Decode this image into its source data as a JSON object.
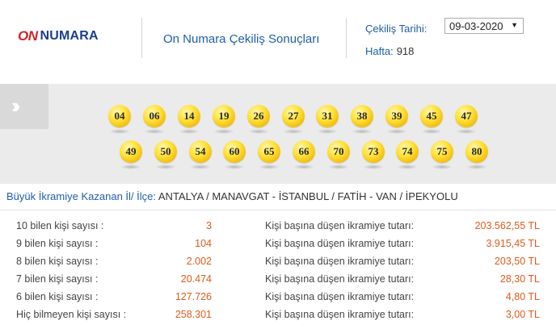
{
  "header": {
    "logo_on": "ON",
    "logo_numara": "NUMARA",
    "page_title": "On Numara Çekiliş Sonuçları",
    "date_label": "Çekiliş Tarihi:",
    "date_value": "09-03-2020",
    "week_label": "Hafta:",
    "week_value": "918"
  },
  "balls": {
    "row1": [
      "04",
      "06",
      "14",
      "19",
      "26",
      "27",
      "31",
      "38",
      "39",
      "45",
      "47"
    ],
    "row2": [
      "49",
      "50",
      "54",
      "60",
      "65",
      "66",
      "70",
      "73",
      "74",
      "75",
      "80"
    ]
  },
  "winners": {
    "label": "Büyük İkramiye Kazanan İl/ İlçe:",
    "value": "ANTALYA / MANAVGAT - İSTANBUL / FATİH - VAN / İPEKYOLU"
  },
  "results": [
    {
      "label": "10 bilen kişi sayısı :",
      "count": "3",
      "prize_label": "Kişi başına düşen ikramiye tutarı:",
      "prize": "203.562,55 TL"
    },
    {
      "label": "9 bilen kişi sayısı :",
      "count": "104",
      "prize_label": "Kişi başına düşen ikramiye tutarı:",
      "prize": "3.915,45 TL"
    },
    {
      "label": "8 bilen kişi sayısı :",
      "count": "2.002",
      "prize_label": "Kişi başına düşen ikramiye tutarı:",
      "prize": "203,50 TL"
    },
    {
      "label": "7 bilen kişi sayısı :",
      "count": "20.474",
      "prize_label": "Kişi başına düşen ikramiye tutarı:",
      "prize": "28,30 TL"
    },
    {
      "label": "6 bilen kişi sayısı :",
      "count": "127.726",
      "prize_label": "Kişi başına düşen ikramiye tutarı:",
      "prize": "4,80 TL"
    },
    {
      "label": "Hiç bilmeyen kişi sayısı :",
      "count": "258.301",
      "prize_label": "Kişi başına düşen ikramiye tutarı:",
      "prize": "3,00 TL"
    }
  ],
  "colors": {
    "brand_red": "#d32128",
    "brand_blue": "#1a3f8c",
    "link_blue": "#1f5ea8",
    "value_orange": "#e05a1a",
    "ball_yellow": "#ffe23a",
    "band_gray": "#ebebeb"
  },
  "icons": {
    "left_tab": "double-chevron-right-icon",
    "select_arrow": "triangle-down-icon"
  }
}
